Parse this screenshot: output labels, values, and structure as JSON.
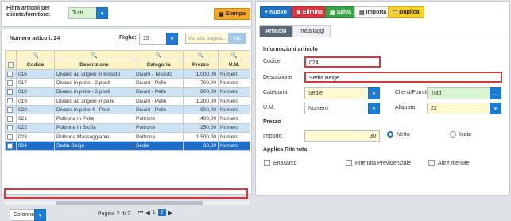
{
  "filter": {
    "label": "Filtra articoli per cliente/fornitore:",
    "value": "Tutti",
    "print_label": "Stampa"
  },
  "list": {
    "count_label": "Numero articoli: 24",
    "rows_label": "Righe:",
    "rows_value": "15",
    "search_placeholder": "Vai alla pagina...",
    "go_label": "Vai",
    "columns": [
      "Codice",
      "Descrizione",
      "Categoria",
      "Prezzo",
      "U.M."
    ],
    "rows": [
      {
        "code": "016",
        "desc": "Divano ad angolo in tessuto",
        "cat": "Divani - Tessuto",
        "price": "1.000,00",
        "um": "Numero"
      },
      {
        "code": "017",
        "desc": "Divano in pelle - 2 posti",
        "cat": "Divani - Pelle",
        "price": "700,00",
        "um": "Numero"
      },
      {
        "code": "018",
        "desc": "Divano in pelle - 3 posti",
        "cat": "Divani - Pelle",
        "price": "800,00",
        "um": "Numero"
      },
      {
        "code": "019",
        "desc": "Divano ad angolo in pelle",
        "cat": "Divani - Pelle",
        "price": "1.200,00",
        "um": "Numero"
      },
      {
        "code": "020",
        "desc": "Divano in pelle 4 - Posti",
        "cat": "Divani - Pelle",
        "price": "900,00",
        "um": "Numero"
      },
      {
        "code": "021",
        "desc": "Poltrona in Pelle",
        "cat": "Poltrone",
        "price": "400,00",
        "um": "Numero"
      },
      {
        "code": "022",
        "desc": "Poltrona in Stoffa",
        "cat": "Poltrone",
        "price": "250,00",
        "um": "Numero"
      },
      {
        "code": "023",
        "desc": "Poltrona Massaggiante",
        "cat": "Poltrone",
        "price": "1.500,00",
        "um": "Numero"
      },
      {
        "code": "024",
        "desc": "Sedia Beige",
        "cat": "Sedie",
        "price": "30,00",
        "um": "Numero"
      }
    ],
    "columns_btn": "Colonne",
    "page_info": "Pagina 2 di 2",
    "page_first": "1",
    "page_current": "2"
  },
  "toolbar": {
    "new": "Nuovo",
    "delete": "Elimina",
    "save": "Salva",
    "import": "Importa",
    "duplicate": "Duplica"
  },
  "tabs": [
    "Articolo",
    "Imballaggi"
  ],
  "form": {
    "section_info": "Informazioni articolo",
    "code_label": "Codice",
    "code_value": "024",
    "desc_label": "Descrizione",
    "desc_value": "Sedia Beige",
    "cat_label": "Categoria",
    "cat_value": "Sedie",
    "clients_label": "Clienti/Fornitori",
    "clients_value": "Tutti",
    "um_label": "U.M.",
    "um_value": "Numero",
    "vat_label": "Aliquota",
    "vat_value": "22",
    "section_price": "Prezzo",
    "amount_label": "Importo",
    "amount_value": "30",
    "net_label": "Netto",
    "vat_incl_label": "Ivato",
    "section_withholding": "Applica Ritenuta",
    "enasarco": "Enasarco",
    "welfare": "Ritenuta Previdenziale",
    "other": "Altre ritenute"
  }
}
